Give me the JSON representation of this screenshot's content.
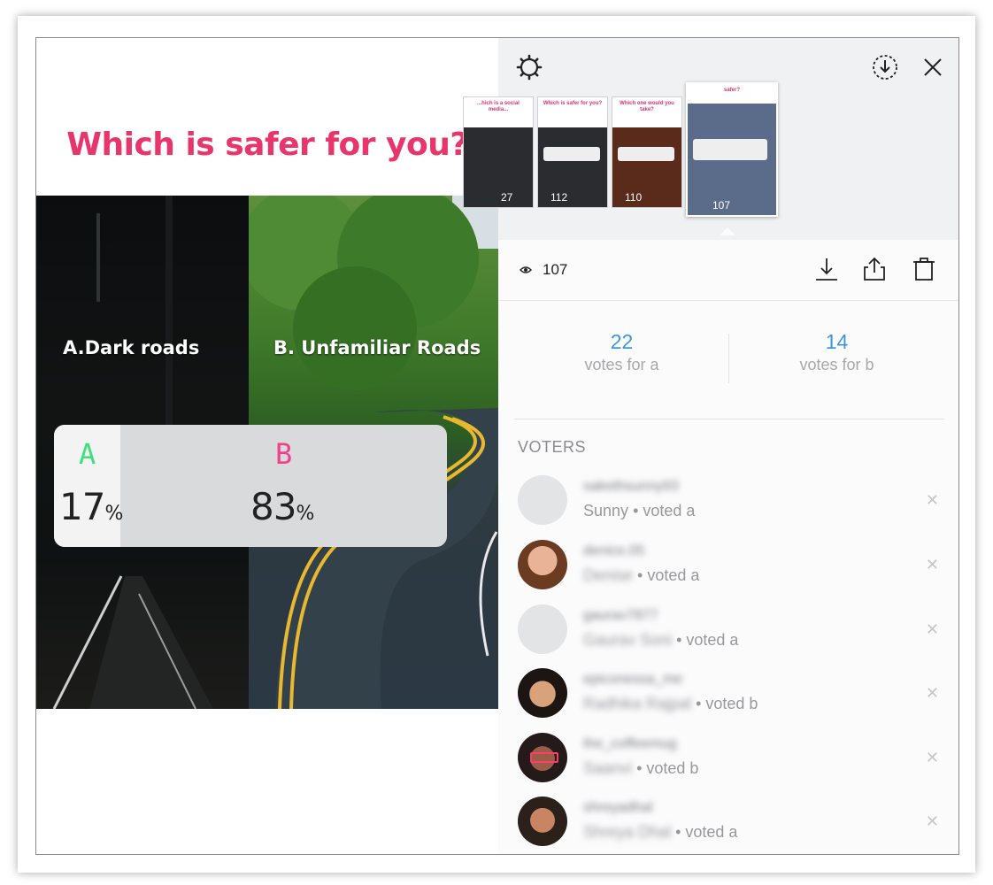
{
  "story": {
    "question": "Which is safer for you?",
    "option_a_label": "A.Dark roads",
    "option_b_label": "B. Unfamiliar Roads",
    "result": {
      "a_letter": "A",
      "b_letter": "B",
      "a_percent": "17",
      "b_percent": "83",
      "percent_sign": "%",
      "a_fraction": 0.17
    }
  },
  "topbar": {
    "thumbnails": [
      {
        "title": "...hich is a social media...",
        "count": "27"
      },
      {
        "title": "Which is safer for you?",
        "count": "112"
      },
      {
        "title": "Which one would you take?",
        "count": "110"
      },
      {
        "title": "safer?",
        "count": "107"
      }
    ]
  },
  "statsbar": {
    "view_count": "107"
  },
  "votes": {
    "a_count": "22",
    "a_label": "votes for a",
    "b_count": "14",
    "b_label": "votes for b"
  },
  "voters": {
    "heading": "VOTERS",
    "list": [
      {
        "username": "sakethsunny93",
        "name": "Sunny",
        "vote": "• voted a",
        "name_blurred": false
      },
      {
        "username": "denice.05",
        "name": "Denise",
        "vote": "• voted a",
        "name_blurred": true
      },
      {
        "username": "gaurav7877",
        "name": "Gaurav Soni",
        "vote": "• voted a",
        "name_blurred": true
      },
      {
        "username": "epiconessa_me",
        "name": "Radhika Rajpal",
        "vote": "• voted b",
        "name_blurred": true
      },
      {
        "username": "the_coffeemug",
        "name": "Saanvi",
        "vote": "• voted b",
        "name_blurred": true
      },
      {
        "username": "shreyadhal",
        "name": "Shreya Dhal",
        "vote": "• voted a",
        "name_blurred": true
      }
    ]
  },
  "colors": {
    "question": "#e8356b",
    "letter_a": "#3de07d",
    "letter_b": "#f0408e",
    "vote_number": "#3f96e0"
  },
  "icons": [
    "settings-icon",
    "download-circle-icon",
    "close-icon",
    "eye-icon",
    "download-icon",
    "share-icon",
    "trash-icon"
  ]
}
